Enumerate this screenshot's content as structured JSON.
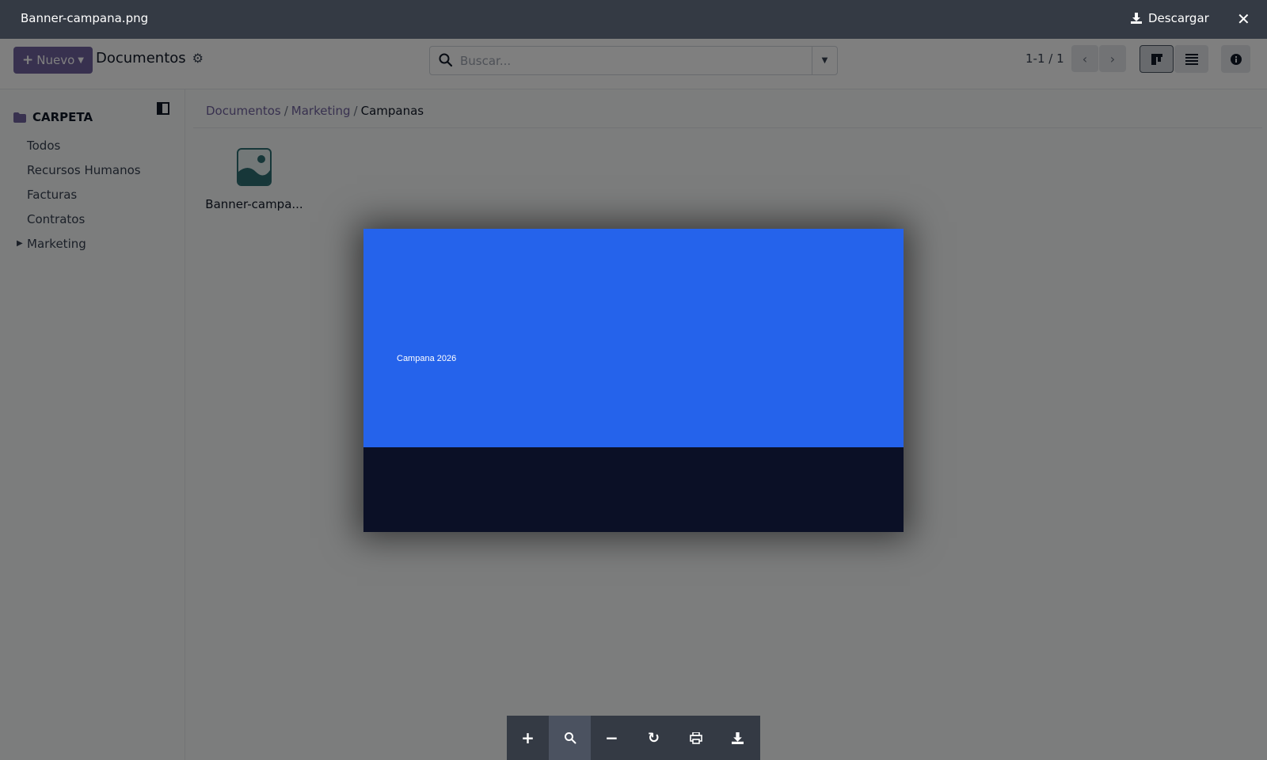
{
  "viewer": {
    "filename": "Banner-campana.png",
    "download_label": "Descargar",
    "image": {
      "caption": "Campana 2026",
      "colors": {
        "top": "#2563eb",
        "bottom": "#0b1026"
      }
    },
    "toolbar": [
      {
        "name": "zoom-in",
        "icon": "plus-icon",
        "glyph": "+"
      },
      {
        "name": "zoom-reset",
        "icon": "search-icon",
        "glyph": ""
      },
      {
        "name": "zoom-out",
        "icon": "minus-icon",
        "glyph": "−"
      },
      {
        "name": "rotate",
        "icon": "rotate-icon",
        "glyph": "↻"
      },
      {
        "name": "print",
        "icon": "print-icon",
        "glyph": ""
      },
      {
        "name": "download",
        "icon": "download-icon",
        "glyph": ""
      }
    ]
  },
  "control_panel": {
    "new_label": "Nuevo",
    "title": "Documentos",
    "search_placeholder": "Buscar...",
    "pager": "1-1 / 1"
  },
  "sidebar": {
    "header": "CARPETA",
    "items": [
      "Todos",
      "Recursos Humanos",
      "Facturas",
      "Contratos",
      "Marketing"
    ]
  },
  "breadcrumb": {
    "items": [
      "Documentos",
      "Marketing"
    ],
    "separator": "/",
    "current": "Campanas"
  },
  "files": [
    {
      "name": "Banner-campa..."
    }
  ],
  "colors": {
    "brand": "#71639e",
    "topbar": "#343a44"
  }
}
